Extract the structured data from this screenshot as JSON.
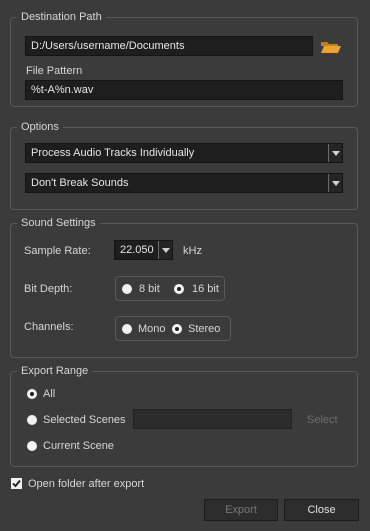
{
  "destination": {
    "title": "Destination Path",
    "path_value": "D:/Users/username/Documents",
    "file_pattern_label": "File Pattern",
    "file_pattern_value": "%t-A%n.wav"
  },
  "options": {
    "title": "Options",
    "tracks_selected": "Process Audio Tracks Individually",
    "break_selected": "Don't Break Sounds"
  },
  "sound": {
    "title": "Sound Settings",
    "sample_rate_label": "Sample Rate:",
    "sample_rate_value": "22.050",
    "sample_rate_unit": "kHz",
    "bit_depth_label": "Bit Depth:",
    "bit_8": "8 bit",
    "bit_16": "16 bit",
    "bit_selected": "16 bit",
    "channels_label": "Channels:",
    "mono": "Mono",
    "stereo": "Stereo",
    "channel_selected": "Stereo"
  },
  "export_range": {
    "title": "Export Range",
    "all": "All",
    "selected_scenes": "Selected Scenes",
    "select_button": "Select",
    "current_scene": "Current Scene",
    "selected": "All"
  },
  "open_folder": {
    "label": "Open folder after export",
    "checked": true
  },
  "buttons": {
    "export": "Export",
    "close": "Close"
  },
  "colors": {
    "background": "#3b3b3b",
    "field": "#1e1e1e",
    "folder_icon": "#e39a2d"
  }
}
